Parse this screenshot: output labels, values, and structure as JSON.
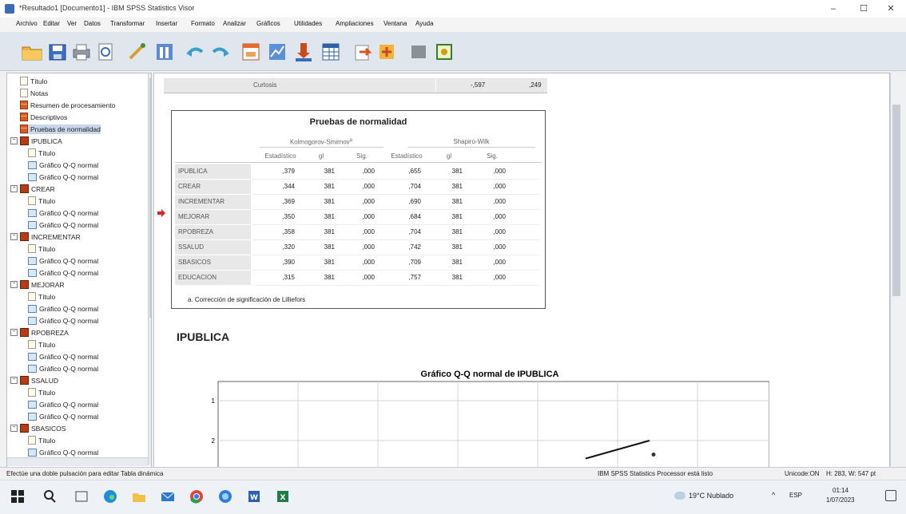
{
  "window": {
    "title": "*Resultado1 [Documento1] - IBM SPSS Statistics Visor",
    "minimize": "–",
    "maximize": "☐",
    "close": "✕"
  },
  "menu": [
    "Archivo",
    "Editar",
    "Ver",
    "Datos",
    "Transformar",
    "Insertar",
    "Formato",
    "Analizar",
    "Gráficos",
    "Utilidades",
    "Ampliaciones",
    "Ventana",
    "Ayuda"
  ],
  "toolbar_icons": [
    "open-folder-icon",
    "save-icon",
    "print-icon",
    "print-preview-icon",
    "export-icon",
    "recall-dialog-icon",
    "undo-icon",
    "redo-icon",
    "goto-data-icon",
    "goto-case-icon",
    "variables-icon",
    "chart-builder-icon",
    "designate-window-icon",
    "promote-icon",
    "demote-icon",
    "show-all-icon",
    "hide-icon",
    "insert-output-icon"
  ],
  "nav_tree": [
    {
      "label": "Título",
      "icon": "note",
      "indent": 1
    },
    {
      "label": "Notas",
      "icon": "note",
      "indent": 1
    },
    {
      "label": "Resumen de procesamiento",
      "icon": "tab",
      "indent": 1
    },
    {
      "label": "Descriptivos",
      "icon": "tab",
      "indent": 1
    },
    {
      "label": "Pruebas de normalidad",
      "icon": "tab",
      "indent": 1,
      "selected": true
    },
    {
      "label": "IPUBLICA",
      "icon": "book",
      "indent": 0,
      "expander": "⊟"
    },
    {
      "label": "Título",
      "icon": "note",
      "indent": 2
    },
    {
      "label": "Gráfico Q-Q normal",
      "icon": "chart",
      "indent": 2
    },
    {
      "label": "Gráfico Q-Q normal",
      "icon": "chart",
      "indent": 2
    },
    {
      "label": "CREAR",
      "icon": "book",
      "indent": 0,
      "expander": "⊟"
    },
    {
      "label": "Título",
      "icon": "note",
      "indent": 2
    },
    {
      "label": "Gráfico Q-Q normal",
      "icon": "chart",
      "indent": 2
    },
    {
      "label": "Gráfico Q-Q normal",
      "icon": "chart",
      "indent": 2
    },
    {
      "label": "INCREMENTAR",
      "icon": "book",
      "indent": 0,
      "expander": "⊟"
    },
    {
      "label": "Título",
      "icon": "note",
      "indent": 2
    },
    {
      "label": "Gráfico Q-Q normal",
      "icon": "chart",
      "indent": 2
    },
    {
      "label": "Gráfico Q-Q normal",
      "icon": "chart",
      "indent": 2
    },
    {
      "label": "MEJORAR",
      "icon": "book",
      "indent": 0,
      "expander": "⊟"
    },
    {
      "label": "Título",
      "icon": "note",
      "indent": 2
    },
    {
      "label": "Gráfico Q-Q normal",
      "icon": "chart",
      "indent": 2
    },
    {
      "label": "Gráfico Q-Q normal",
      "icon": "chart",
      "indent": 2
    },
    {
      "label": "RPOBREZA",
      "icon": "book",
      "indent": 0,
      "expander": "⊟"
    },
    {
      "label": "Título",
      "icon": "note",
      "indent": 2
    },
    {
      "label": "Gráfico Q-Q normal",
      "icon": "chart",
      "indent": 2
    },
    {
      "label": "Gráfico Q-Q normal",
      "icon": "chart",
      "indent": 2
    },
    {
      "label": "SSALUD",
      "icon": "book",
      "indent": 0,
      "expander": "⊟"
    },
    {
      "label": "Título",
      "icon": "note",
      "indent": 2
    },
    {
      "label": "Gráfico Q-Q normal",
      "icon": "chart",
      "indent": 2
    },
    {
      "label": "Gráfico Q-Q normal",
      "icon": "chart",
      "indent": 2
    },
    {
      "label": "SBASICOS",
      "icon": "book",
      "indent": 0,
      "expander": "⊟"
    },
    {
      "label": "Título",
      "icon": "note",
      "indent": 2
    },
    {
      "label": "Gráfico Q-Q normal",
      "icon": "chart",
      "indent": 2
    }
  ],
  "prev_table": {
    "row_label": "Curtosis",
    "value": "-,597",
    "stderr": ",249"
  },
  "normality_table": {
    "title": "Pruebas de normalidad",
    "group1": "Kolmogorov-Smirnov",
    "group1_sup": "a",
    "group2": "Shapiro-Wilk",
    "col_headers": [
      "Estadístico",
      "gl",
      "Sig.",
      "Estadístico",
      "gl",
      "Sig."
    ],
    "rows": [
      {
        "label": "IPUBLICA",
        "cells": [
          ",379",
          "381",
          ",000",
          ",655",
          "381",
          ",000"
        ]
      },
      {
        "label": "CREAR",
        "cells": [
          ",344",
          "381",
          ",000",
          ",704",
          "381",
          ",000"
        ]
      },
      {
        "label": "INCREMENTAR",
        "cells": [
          ",369",
          "381",
          ",000",
          ",690",
          "381",
          ",000"
        ]
      },
      {
        "label": "MEJORAR",
        "cells": [
          ",350",
          "381",
          ",000",
          ",684",
          "381",
          ",000"
        ]
      },
      {
        "label": "RPOBREZA",
        "cells": [
          ",358",
          "381",
          ",000",
          ",704",
          "381",
          ",000"
        ]
      },
      {
        "label": "SSALUD",
        "cells": [
          ",320",
          "381",
          ",000",
          ",742",
          "381",
          ",000"
        ]
      },
      {
        "label": "SBASICOS",
        "cells": [
          ",390",
          "381",
          ",000",
          ",709",
          "381",
          ",000"
        ]
      },
      {
        "label": "EDUCACION",
        "cells": [
          ",315",
          "381",
          ",000",
          ",757",
          "381",
          ",000"
        ]
      }
    ],
    "footnote": "a. Corrección de significación de Lilliefors"
  },
  "section_heading": "IPUBLICA",
  "chart_data": {
    "type": "scatter",
    "title": "Gráfico Q-Q normal de IPUBLICA",
    "xlabel": "",
    "ylabel": "",
    "y_ticks": [
      "2",
      "1"
    ],
    "grid": true,
    "reference_line": [
      [
        4.6,
        0.55
      ],
      [
        5.4,
        1.0
      ]
    ],
    "points": [
      [
        5.45,
        0.65
      ]
    ]
  },
  "status": {
    "left": "Efectúe una doble pulsación para editar Tabla dinámica",
    "processor": "IBM SPSS Statistics Processor está listo",
    "unicode": "Unicode:ON",
    "dims": "H: 283, W: 547 pt"
  },
  "taskbar": {
    "weather": "19°C Nublado",
    "lang": "ESP",
    "time": "01:14",
    "date": "1/07/2023",
    "icons": [
      "windows-start-icon",
      "search-icon",
      "task-view-icon",
      "edge-icon",
      "file-explorer-icon",
      "mail-icon",
      "chrome-icon",
      "browser-icon",
      "word-icon",
      "excel-icon"
    ]
  },
  "colors": {
    "accent": "#3a6db5",
    "selected_nav": "#c8d7ea",
    "row_header_bg": "#e8e8e8",
    "arrow": "#e02020"
  }
}
